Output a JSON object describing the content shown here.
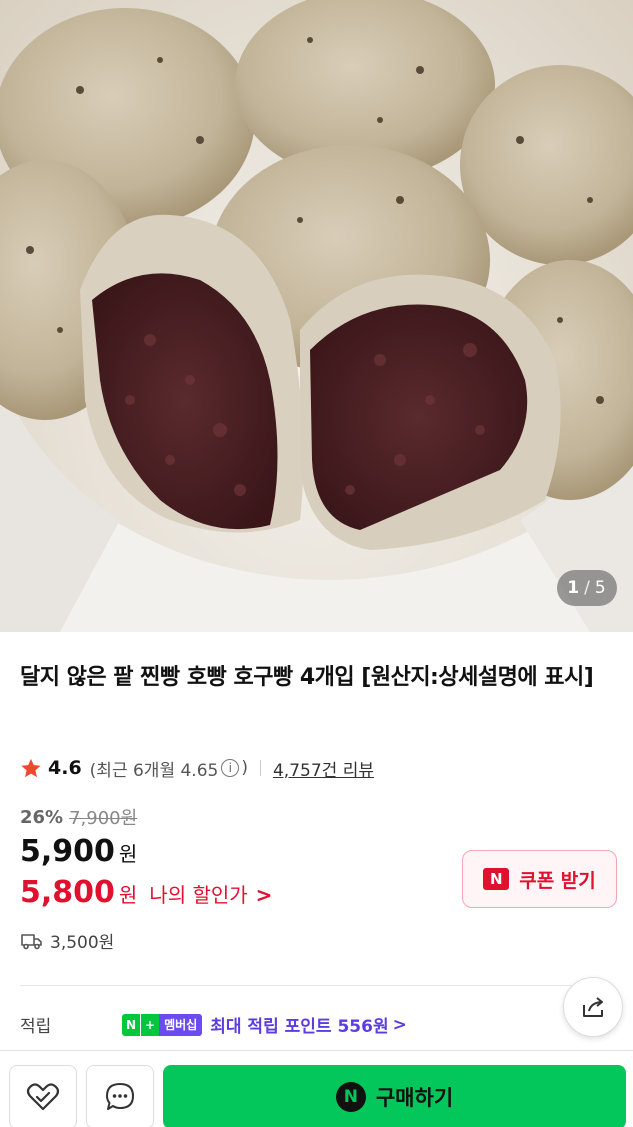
{
  "image": {
    "pager_current": "1",
    "pager_separator": "/",
    "pager_total": "5"
  },
  "product": {
    "title": "달지 않은 팥 찐빵 호빵 호구빵 4개입 [원산지:상세설명에 표시]",
    "rating": "4.6",
    "recent_rating_text": "(최근 6개월 4.65",
    "recent_rating_close": ")",
    "info_icon_glyph": "i",
    "review_link": "4,757건 리뷰",
    "discount_rate": "26%",
    "original_price": "7,900원",
    "price": "5,900",
    "price_unit": "원",
    "my_price": "5,800",
    "my_price_unit": "원",
    "my_price_label": "나의 할인가",
    "my_price_chevron": ">",
    "coupon_badge": "N",
    "coupon_label": "쿠폰 받기",
    "delivery_fee": "3,500원"
  },
  "points": {
    "label": "적립",
    "badge_n": "N",
    "badge_plus": "+",
    "badge_membership": "멤버십",
    "text": "최대 적립 포인트 556원",
    "chevron": ">"
  },
  "bottom_bar": {
    "buy_badge": "N",
    "buy_label": "구매하기"
  },
  "colors": {
    "accent_red": "#e0102f",
    "naver_green": "#03c75a",
    "membership_purple": "#5b3de0"
  },
  "icons": [
    "star-icon",
    "info-icon",
    "truck-icon",
    "share-icon",
    "heart-check-icon",
    "chat-icon",
    "naver-n-icon"
  ]
}
